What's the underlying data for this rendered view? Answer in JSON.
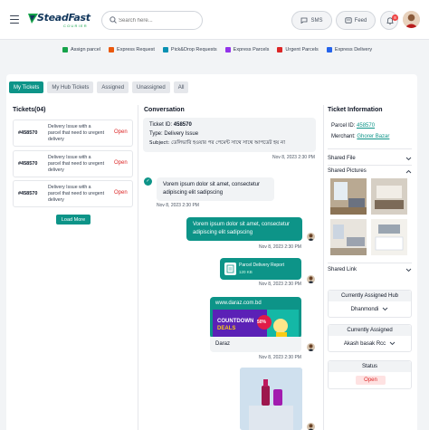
{
  "header": {
    "logo_text": "SteadFast",
    "logo_sub": "COURIER",
    "search_placeholder": "Search here...",
    "sms_label": "SMS",
    "feed_label": "Feed",
    "notification_count": "8"
  },
  "quick_actions": [
    {
      "label": "Assign parcel",
      "color": "#16a34a"
    },
    {
      "label": "Express Request",
      "color": "#ea580c"
    },
    {
      "label": "Pick&Drop Requests",
      "color": "#0891b2"
    },
    {
      "label": "Express Parcels",
      "color": "#9333ea"
    },
    {
      "label": "Urgent Parcels",
      "color": "#dc2626"
    },
    {
      "label": "Express Delivery",
      "color": "#2563eb"
    }
  ],
  "tabs": [
    "My Tickets",
    "My Hub Tickets",
    "Assigned",
    "Unassigned",
    "All"
  ],
  "tickets_panel": {
    "title": "Tickets(04)",
    "items": [
      {
        "id": "#458570",
        "desc": "Delivery Issue with a parcel that need to uregent delivery",
        "status": "Open"
      },
      {
        "id": "#458570",
        "desc": "Delivery Issue with a parcel that need to uregent delivery",
        "status": "Open"
      },
      {
        "id": "#458570",
        "desc": "Delivery Issue with a parcel that need to uregent delivery",
        "status": "Open"
      }
    ],
    "load_more": "Load More"
  },
  "conversation": {
    "title": "Conversation",
    "ticket_id_label": "Ticket ID:",
    "ticket_id": "458570",
    "type_label": "Type:",
    "type": "Delivery Issue",
    "subject_label": "Subject:",
    "subject": "ডেলিভারি হওয়ার পর পেমেন্ট সাথে সাথে আপডেট হয় না",
    "info_time": "Nov 8, 2023 2:30 PM",
    "received_msg": "Vorem ipsum dolor sit amet, consectetur adipiscing elit sadipscing",
    "received_time": "Nov 8, 2023 2:30 PM",
    "sent_msg": "Vorem ipsum dolor sit amet, consectetur adipiscing elit sadipscing",
    "sent_time": "Nov 8, 2023 2:30 PM",
    "file_name": "Parcel Delivery Report",
    "file_size": "120 KB",
    "file_time": "Nov 8, 2023 2:30 PM",
    "link_url": "www.daraz.com.bd",
    "banner_title": "COUNTDOWN",
    "banner_sub": "DEALS",
    "banner_percent": "50%",
    "link_caption": "Daraz",
    "link_time": "Nov 8, 2023 2:30 PM"
  },
  "ticket_info": {
    "title": "Ticket Information",
    "parcel_id_label": "Parcel ID:",
    "parcel_id": "458570",
    "merchant_label": "Merchant:",
    "merchant": "Ghorer Bazar",
    "shared_file": "Shared File",
    "shared_pictures": "Shared Pictures",
    "shared_link": "Shared Link",
    "hub_label": "Currently Assigned Hub",
    "hub_value": "Dhanmondi",
    "assigned_label": "Currently Assigned",
    "assigned_value": "Akash basak Rcc",
    "status_label": "Status",
    "status_value": "Open"
  },
  "colors": {
    "accent": "#0d9488",
    "danger": "#dc2626",
    "navy": "#12375c"
  }
}
